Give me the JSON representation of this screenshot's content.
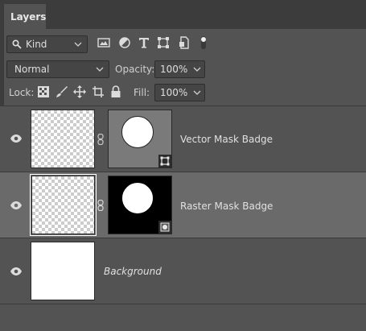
{
  "panel": {
    "tab_label": "Layers"
  },
  "filter": {
    "kind_label": "Kind",
    "icons": [
      "image-filter-icon",
      "adjustment-filter-icon",
      "type-filter-icon",
      "shape-filter-icon",
      "smart-object-filter-icon",
      "filter-toggle-icon"
    ]
  },
  "blend": {
    "mode": "Normal",
    "opacity_label": "Opacity:",
    "opacity_value": "100%"
  },
  "lock": {
    "label": "Lock:",
    "icons": [
      "lock-transparent-pixels-icon",
      "lock-image-pixels-icon",
      "lock-position-icon",
      "lock-artboard-icon",
      "lock-all-icon"
    ],
    "fill_label": "Fill:",
    "fill_value": "100%"
  },
  "layers": [
    {
      "name": "Vector Mask Badge",
      "mask_type": "vector",
      "selected": false
    },
    {
      "name": "Raster Mask Badge",
      "mask_type": "raster",
      "selected": true
    },
    {
      "name": "Background",
      "mask_type": "none",
      "selected": false
    }
  ],
  "colors": {
    "panel_bg": "#535353",
    "selected_layer_bg": "#6a6a6a",
    "tab_bar_bg": "#3c3c3c"
  }
}
